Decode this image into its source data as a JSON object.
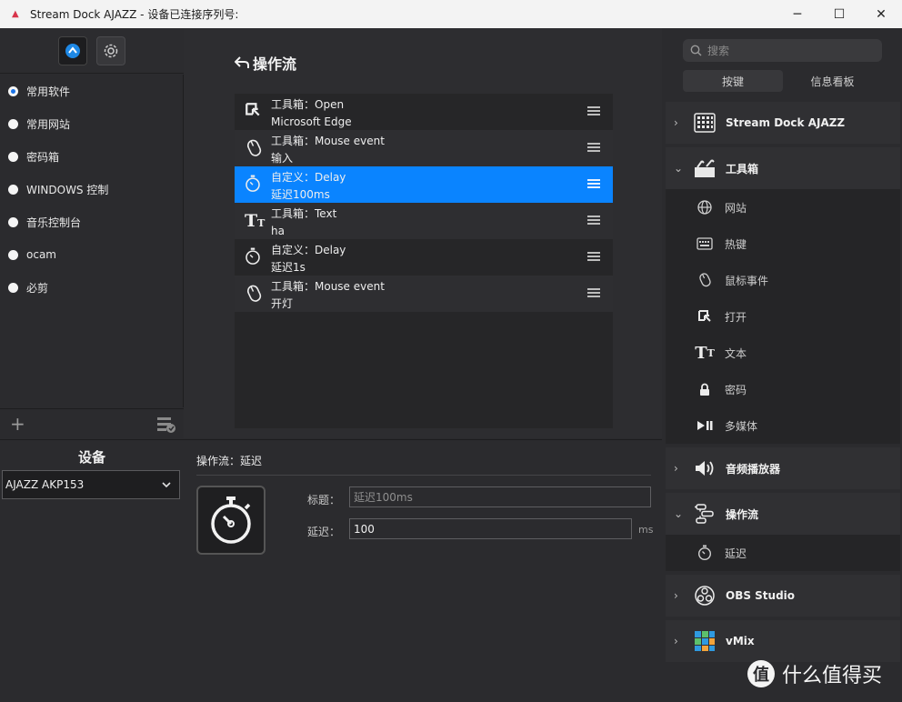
{
  "window": {
    "title": "Stream Dock AJAZZ - 设备已连接序列号:",
    "minimize": "─",
    "maximize": "☐",
    "close": "✕"
  },
  "profiles": [
    {
      "label": "常用软件",
      "checked": true
    },
    {
      "label": "常用网站",
      "checked": false
    },
    {
      "label": "密码箱",
      "checked": false
    },
    {
      "label": "WINDOWS 控制",
      "checked": false
    },
    {
      "label": "音乐控制台",
      "checked": false
    },
    {
      "label": "ocam",
      "checked": false
    },
    {
      "label": "必剪",
      "checked": false
    }
  ],
  "left": {
    "add": "+",
    "device_label": "设备",
    "device_value": "AJAZZ AKP153"
  },
  "flow": {
    "title": "操作流",
    "items": [
      {
        "line1": "工具箱：Open",
        "line2": "Microsoft Edge",
        "icon": "open-icon"
      },
      {
        "line1": "工具箱：Mouse event",
        "line2": "输入",
        "icon": "mouse-icon"
      },
      {
        "line1": "自定义：Delay",
        "line2": "延迟100ms",
        "icon": "stopwatch-icon"
      },
      {
        "line1": "工具箱：Text",
        "line2": "ha",
        "icon": "text-icon"
      },
      {
        "line1": "自定义：Delay",
        "line2": "延迟1s",
        "icon": "stopwatch-icon"
      },
      {
        "line1": "工具箱：Mouse event",
        "line2": "开灯",
        "icon": "mouse-icon"
      }
    ]
  },
  "detail": {
    "title": "操作流：延迟",
    "title_label": "标题：",
    "title_placeholder": "延迟100ms",
    "delay_label": "延迟：",
    "delay_value": "100",
    "delay_unit": "ms"
  },
  "right": {
    "search_placeholder": "搜索",
    "tab_keys": "按键",
    "tab_board": "信息看板",
    "categories": {
      "streamdock": "Stream Dock AJAZZ",
      "toolbox": "工具箱",
      "audio": "音频播放器",
      "flow": "操作流",
      "obs": "OBS Studio",
      "vmix": "vMix"
    },
    "toolbox_items": [
      "网站",
      "热键",
      "鼠标事件",
      "打开",
      "文本",
      "密码",
      "多媒体"
    ],
    "flow_items": [
      "延迟"
    ]
  },
  "watermark": {
    "logo": "值",
    "text": "什么值得买"
  },
  "colors": {
    "accent": "#0a84ff",
    "background": "#2b2b2e"
  }
}
